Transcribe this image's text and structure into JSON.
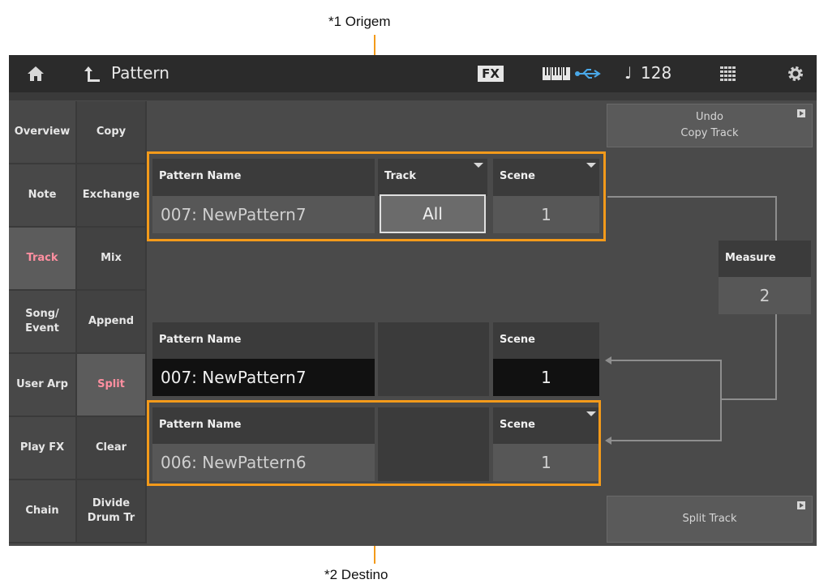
{
  "annotations": {
    "source_label": "*1 Origem",
    "dest_label": "*2 Destino"
  },
  "topbar": {
    "home_icon": "home-icon",
    "back_icon": "return-arrow-icon",
    "title": "Pattern",
    "fx_label": "FX",
    "keyboard_icon": "keyboard-icon",
    "usb_icon": "usb-icon",
    "tempo_symbol": "♩",
    "tempo_value": "128",
    "grid_icon": "grid-icon",
    "settings_icon": "gear-icon"
  },
  "nav_col1": [
    "Overview",
    "Note",
    "Track",
    "Song/\nEvent",
    "User Arp",
    "Play FX",
    "Chain"
  ],
  "nav_col2": [
    "Copy",
    "Exchange",
    "Mix",
    "Append",
    "Split",
    "Clear",
    "Divide\nDrum Tr"
  ],
  "active": {
    "col1": "Track",
    "col2": "Split"
  },
  "source": {
    "pattern_name_label": "Pattern Name",
    "pattern_name_value": "007: NewPattern7",
    "track_label": "Track",
    "track_value": "All",
    "scene_label": "Scene",
    "scene_value": "1"
  },
  "measure": {
    "label": "Measure",
    "value": "2"
  },
  "dest1": {
    "pattern_name_label": "Pattern Name",
    "pattern_name_value": "007: NewPattern7",
    "scene_label": "Scene",
    "scene_value": "1"
  },
  "dest2": {
    "pattern_name_label": "Pattern Name",
    "pattern_name_value": "006: NewPattern6",
    "scene_label": "Scene",
    "scene_value": "1"
  },
  "buttons": {
    "undo_line1": "Undo",
    "undo_line2": "Copy Track",
    "split_track": "Split Track"
  },
  "colors": {
    "accent_orange": "#f39a1a",
    "active_tab_text": "#ff8fa0"
  }
}
